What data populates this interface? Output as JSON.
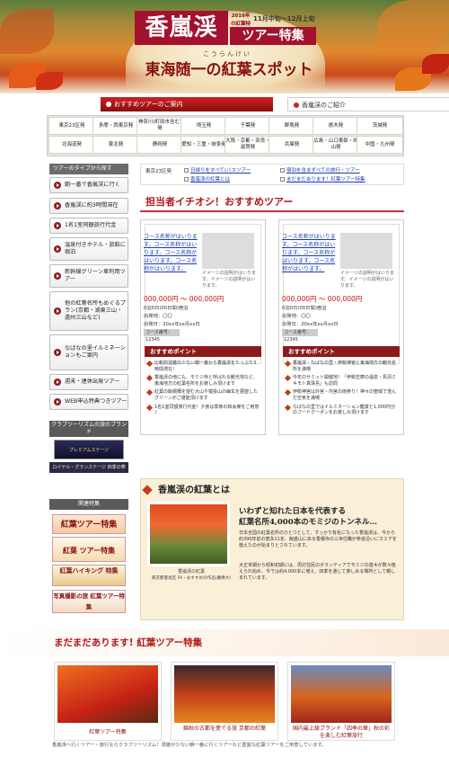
{
  "header": {
    "title_kanji": "香嵐渓",
    "title_note": "2016年の紅葉特集",
    "title_date": "11月中旬〜12月上旬",
    "title_tour": "ツアー特集",
    "reading": "こうらんけい",
    "subtitle": "東海随一の紅葉スポット"
  },
  "tabs": {
    "recommend": "おすすめツアーのご案内",
    "intro": "香嵐渓のご紹介"
  },
  "regions": [
    [
      "東京23区発",
      "多摩・西東京発",
      "神奈川(町田市含む)発",
      "埼玉発",
      "千葉発",
      "群馬発",
      "栃木発",
      "茨城発"
    ],
    [
      "北海道発",
      "東北発",
      "静岡発",
      "愛知・三重・岐阜発",
      "大阪・京都・奈良・滋賀発",
      "兵庫発",
      "広島・山口東部・岡山発",
      "中国・九州発"
    ]
  ],
  "sidebar": {
    "heading": "ツアーのタイプから探す",
    "items": [
      "朝一番で香嵐渓に行く",
      "香嵐渓に約3時間滞在",
      "1名1室同額旅行代金",
      "温泉付きホテル・旅館に宿泊",
      "新幹線グリーン車利用ツアー",
      "他の紅葉名所もめぐるプラン(京都・湖東三山・遠州三山など)",
      "なばなの里イルミネーションもご案内",
      "週末・連休出発ツアー",
      "WEB申込特典つきツアー"
    ],
    "club_heading": "クラブツーリズムの旅のブランド",
    "club_banner": "プレミアムステージ",
    "club_banner2": "ロイヤル・グランステージ 四季の華",
    "related_heading": "関連特集",
    "related": [
      "紅葉ツアー特集",
      "紅葉 ツアー特集",
      "紅葉ハイキング 特集",
      "写真撮影の旅 紅葉ツアー特集"
    ]
  },
  "filters": {
    "label": "東京23区発",
    "links": [
      "日帰りをすべて(バスツアー",
      "宿泊を含まずべての旅行・ツアー",
      "香嵐渓の紅葉とは",
      "まだまだあります！紅葉ツアー特集"
    ]
  },
  "pick": {
    "title": "担当者イチオシ！おすすめツアー"
  },
  "cards": [
    {
      "link": "コース名称がはいります。コース名称がはいります。コース名称がはいります。コース名称がはいります。",
      "img_desc": "イメージの説明がはいります。イメージの説明がはいります。",
      "price": "000,000円 〜 000,000円",
      "nights": "0泊0日(00日間)宿泊",
      "depart": "出発地：〇〇",
      "date": "出発日：20xx年xx月xx日",
      "code": "コース番号：12345",
      "point_head": "おすすめポイント",
      "points": [
        "比較的混雑の少ない朝一番から香嵐渓をたっぷり3時間滞在！",
        "香嵐渓の他にも、モミジ寺と呼ばれる観光地など、東海地方の紅葉名所をお楽しみ頂けます",
        "紅葉の飯綱橋を望む大山や猿投山の幽玄を展望したグリーンがご堪能頂けます",
        "1名1室同額旅行代金！夕食は季節の和会席をご用意♪"
      ]
    },
    {
      "link": "コース名称がはいります。コース名称がはいります。コース名称がはいります。コース名称がはいります。",
      "img_desc": "イメージの説明がはいります。イメージの説明がはいります。",
      "price": "000,000円 〜 000,000円",
      "nights": "0泊0日(00日間)宿泊",
      "depart": "出発地：〇〇",
      "date": "出発日：20xx年xx月xx日",
      "code": "コース番号：12345",
      "point_head": "おすすめポイント",
      "points": [
        "香嵐渓・なばなの里・伊勢神宮と東海地方の観光名所を満喫",
        "今年のサミット開催地！「伊勢志摩の温泉・鳥羽ミキモト真珠島」も訪問",
        "伊勢神宮は外宮・内宮の両参り！神々の聖域で澄んだ空気を満喫",
        "なばなの里ではイルミネーション鑑賞と1,000円分のフードクーポンをお楽しみ頂けます"
      ]
    }
  ],
  "feature": {
    "title": "香嵐渓の紅葉とは",
    "h1": "いわずと知れた日本を代表する",
    "h2": "紅葉名所4,000本のモミジのトンネル…",
    "body1": "日本全国の紅葉名所のひとつとして、すっかり有名になった香嵐渓は、今から約390年前の寛永11年、飯盛山にある香積寺の三世住職が参道沿いにカエデを植えたのが始まりとされています。",
    "body2": "大正末期から昭和初期には、周辺住民のボランティアでモミジの苗木が数々植えられ始め、今では約4,000本に増え、四季を通じて楽しめる場所として親しまれています。",
    "cap1": "香嵐渓の紅葉",
    "cap2": "東京都豊島区 FA・おすすめの作品(慶應大)"
  },
  "more": {
    "title": "まだまだあります! 紅葉ツアー特集",
    "cards": [
      "紅葉ツアー特集",
      "錦秋の古都を愛でる旅 京都の紅葉",
      "国内最上級ブランド「四季の華」秋の彩を楽しむ紅葉旅行"
    ]
  },
  "footer": "香嵐渓へ行くツアー・旅行ならクラブツーリズム！混雑が少ない朝一番に行くツアーなど豊富な紅葉ツアーをご用意しています。"
}
